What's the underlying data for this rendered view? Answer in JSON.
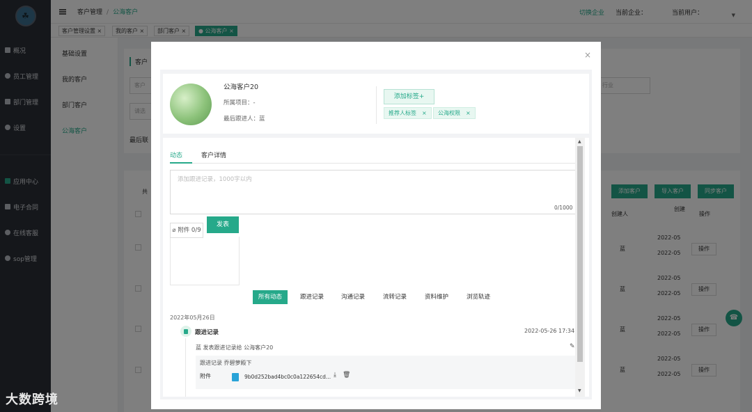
{
  "sidebar": {
    "items": [
      {
        "label": "概况"
      },
      {
        "label": "员工管理"
      },
      {
        "label": "部门管理"
      },
      {
        "label": "设置"
      },
      {
        "label": "应用中心"
      },
      {
        "label": "电子合同"
      },
      {
        "label": "在线客服"
      },
      {
        "label": "sop管理"
      }
    ],
    "watermark": "大数跨境"
  },
  "header": {
    "breadcrumb_root": "客户管理",
    "breadcrumb_sep": "/",
    "breadcrumb_current": "公海客户",
    "switch_company": "切换企业",
    "current_company": "当前企业：",
    "current_user": "当前用户："
  },
  "tabs": [
    {
      "label": "客户管理设置 ×"
    },
    {
      "label": "我的客户 ×"
    },
    {
      "label": "部门客户 ×"
    },
    {
      "label": "● 公海客户 ×"
    }
  ],
  "subnav": [
    "基础设置",
    "我的客户",
    "部门客户",
    "公海客户"
  ],
  "background": {
    "section_title": "客户",
    "select_placeholder": "客户",
    "industry_select": "行业",
    "filter_placeholder": "请选",
    "last_contact_label": "最后联",
    "total_label": "共",
    "buttons": [
      "添加客户",
      "导入客户",
      "同步客户"
    ],
    "columns": [
      "创建人",
      "创建",
      "操作"
    ],
    "rows": [
      {
        "creator": "蓝",
        "date1": "2022-05",
        "date2": "2022-05",
        "op": "操作"
      },
      {
        "creator": "蓝",
        "date1": "2022-05",
        "date2": "2022-05",
        "op": "操作"
      },
      {
        "creator": "蓝",
        "date1": "2022-05",
        "date2": "2022-05",
        "op": "操作"
      },
      {
        "creator": "蓝",
        "date1": "2022-05",
        "date2": "2022-05",
        "op": "操作"
      }
    ]
  },
  "modal": {
    "close": "×",
    "profile": {
      "name": "公海客户20",
      "project": "所属项目：-",
      "follower": "最后跟进人：蓝",
      "add_tag": "添加标签+",
      "tags": [
        {
          "label": "推荐人标签",
          "x": "×"
        },
        {
          "label": "公海权限",
          "x": "×"
        }
      ]
    },
    "content_tabs": [
      "动态",
      "客户详情"
    ],
    "textarea_placeholder": "添加跟进记录，1000字以内",
    "counter": "0/1000",
    "attach_label": "附件 0/9",
    "publish": "发表",
    "filter_tabs": [
      "所有动态",
      "跟进记录",
      "沟通记录",
      "流转记录",
      "资料维护",
      "浏览轨迹"
    ],
    "timeline": {
      "date": "2022年05月26日",
      "entry_title": "跟进记录",
      "entry_time": "2022-05-26 17:34:21",
      "entry_desc": "蓝 发表跟进记录给 公海客户20",
      "record_line": "跟进记录 乔碧萝殿下",
      "attach_label": "附件",
      "file_name": "9b0d252bad4bc0c0a122654cd..."
    }
  }
}
